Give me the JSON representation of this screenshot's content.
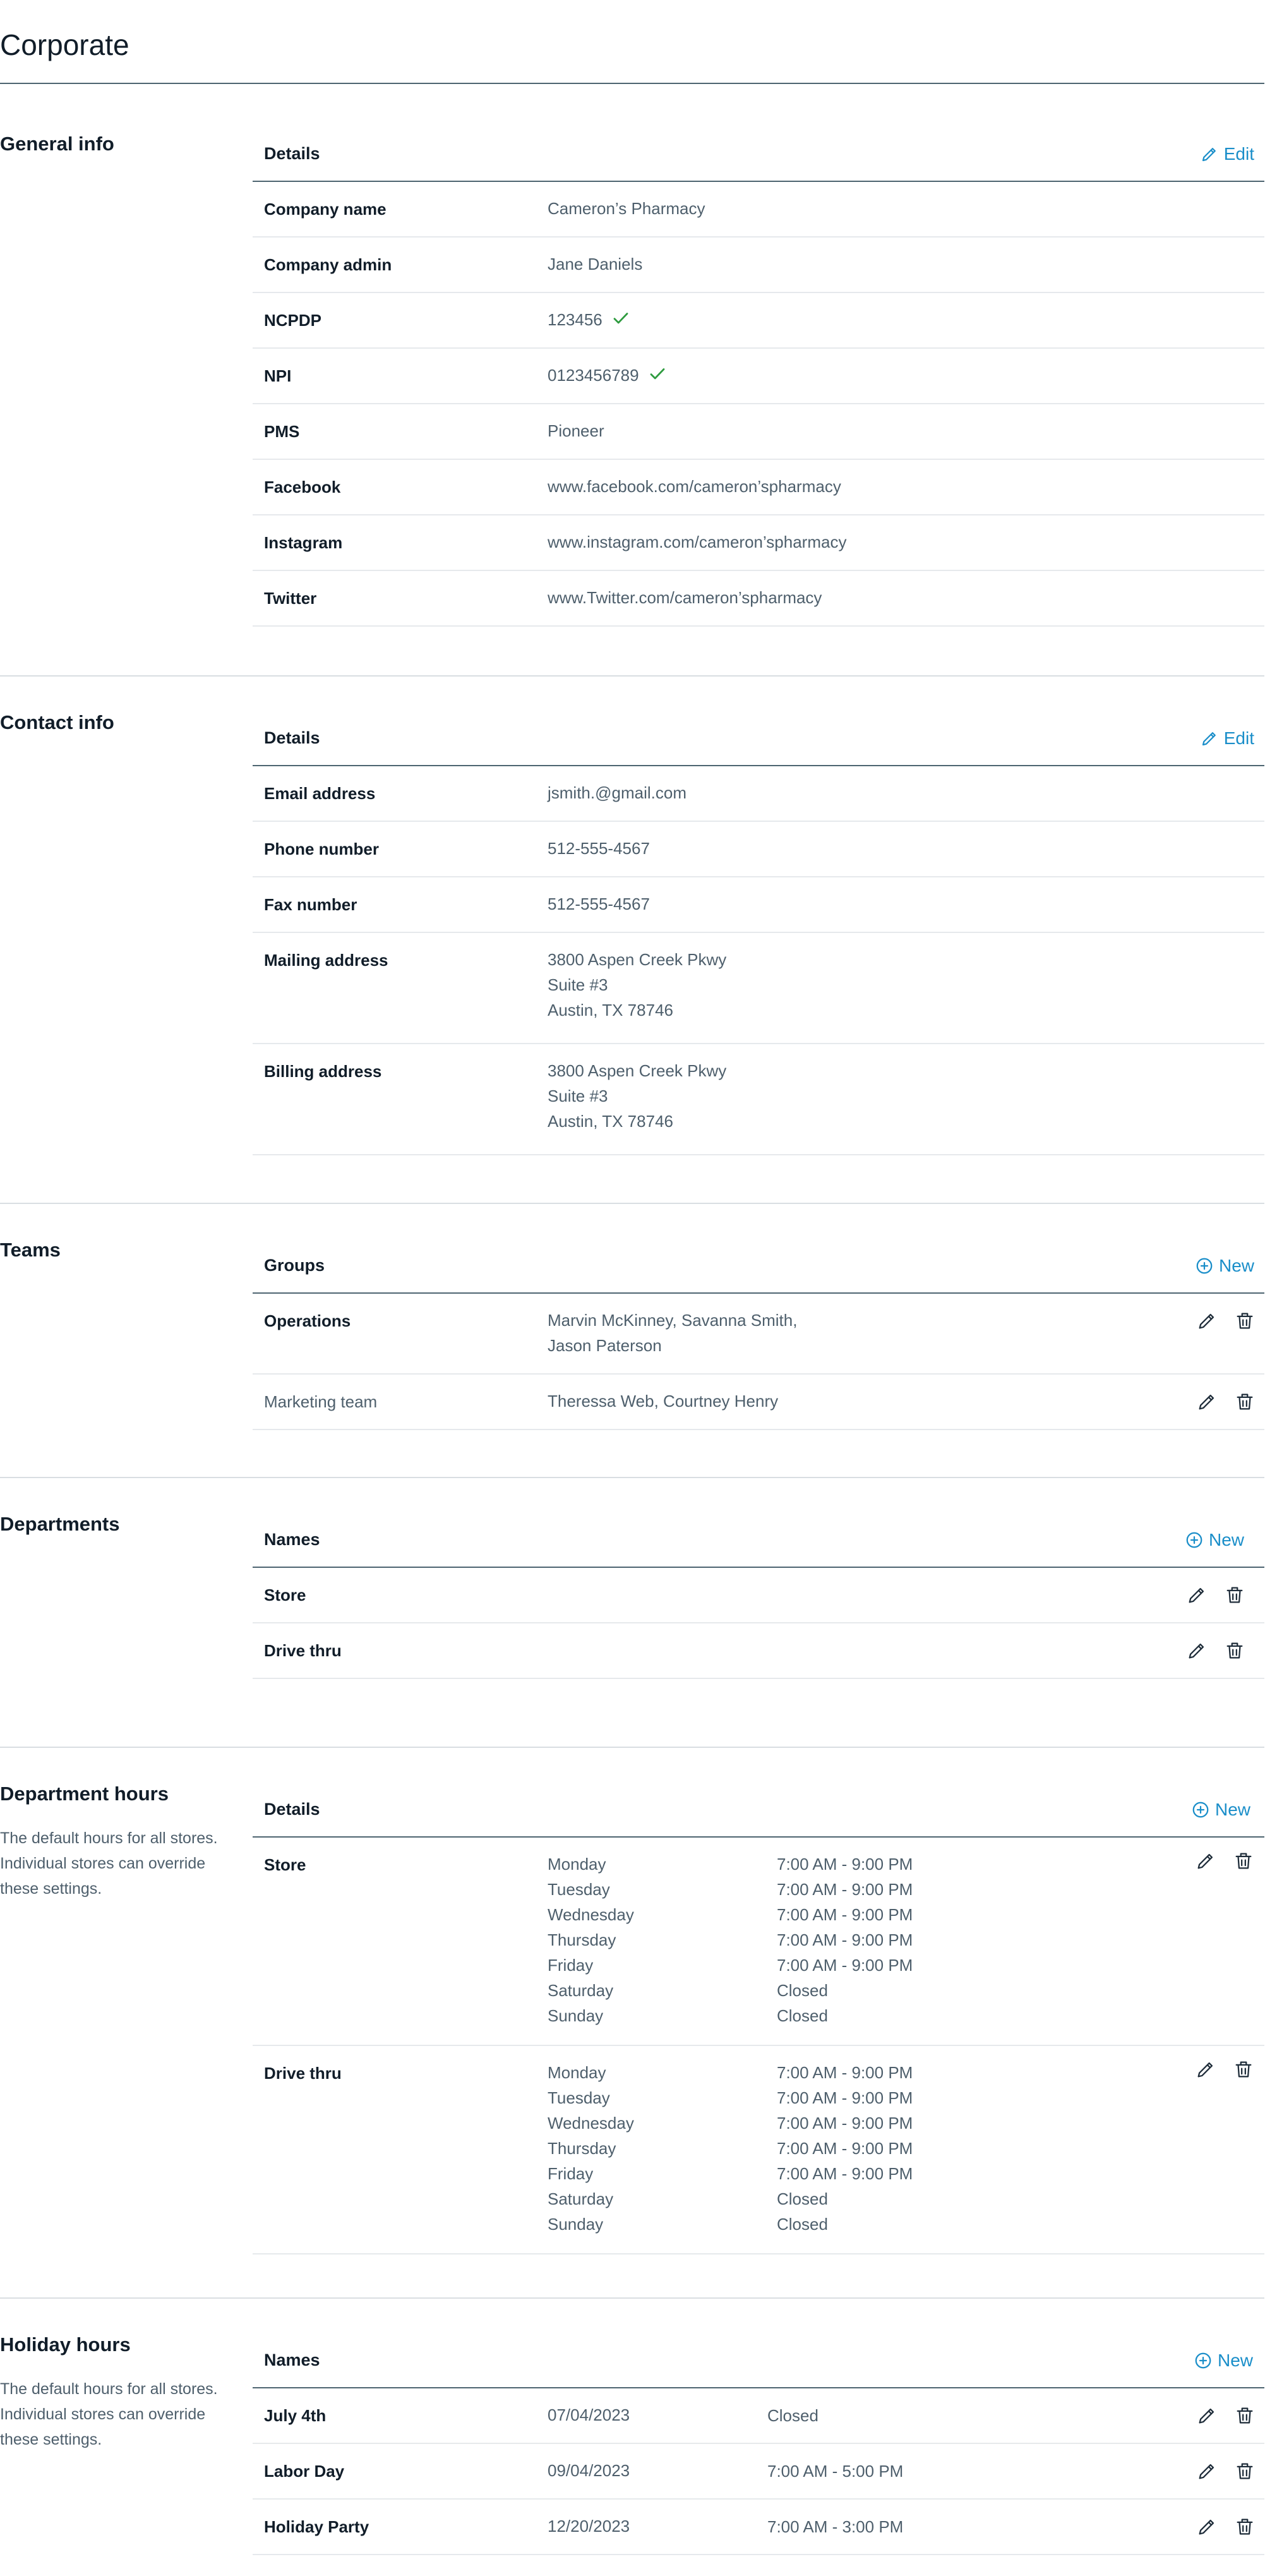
{
  "page": {
    "title": "Corporate"
  },
  "general": {
    "title": "General info",
    "header": "Details",
    "action": "Edit",
    "rows": [
      {
        "label": "Company name",
        "value": "Cameron’s Pharmacy"
      },
      {
        "label": "Company admin",
        "value": "Jane Daniels"
      },
      {
        "label": "NCPDP",
        "value": "123456",
        "verified": true
      },
      {
        "label": "NPI",
        "value": "0123456789",
        "verified": true
      },
      {
        "label": "PMS",
        "value": "Pioneer"
      },
      {
        "label": "Facebook",
        "value": "www.facebook.com/cameron’spharmacy"
      },
      {
        "label": "Instagram",
        "value": "www.instagram.com/cameron’spharmacy"
      },
      {
        "label": "Twitter",
        "value": "www.Twitter.com/cameron’spharmacy"
      }
    ]
  },
  "contact": {
    "title": "Contact info",
    "header": "Details",
    "action": "Edit",
    "rows": [
      {
        "label": "Email address",
        "value": "jsmith.@gmail.com"
      },
      {
        "label": "Phone number",
        "value": "512-555-4567"
      },
      {
        "label": "Fax number",
        "value": "512-555-4567"
      },
      {
        "label": "Mailing address",
        "line1": "3800 Aspen Creek Pkwy",
        "line2": "Suite #3",
        "line3": "Austin, TX 78746"
      },
      {
        "label": "Billing address",
        "line1": "3800 Aspen Creek Pkwy",
        "line2": "Suite #3",
        "line3": "Austin, TX 78746"
      }
    ]
  },
  "teams": {
    "title": "Teams",
    "header": "Groups",
    "action": "New",
    "rows": [
      {
        "label": "Operations",
        "line1": "Marvin McKinney, Savanna Smith,",
        "line2": "Jason Paterson"
      },
      {
        "label": "Marketing team",
        "value": "Theressa Web, Courtney Henry"
      }
    ]
  },
  "departments": {
    "title": "Departments",
    "header": "Names",
    "action": "New",
    "rows": [
      {
        "label": "Store"
      },
      {
        "label": "Drive thru"
      }
    ]
  },
  "dept_hours": {
    "title": "Department hours",
    "description": "The default hours for all stores. Individual stores can override these settings.",
    "header": "Details",
    "action": "New",
    "groups": [
      {
        "label": "Store",
        "days": [
          {
            "day": "Monday",
            "hours": "7:00 AM - 9:00 PM"
          },
          {
            "day": "Tuesday",
            "hours": "7:00 AM - 9:00 PM"
          },
          {
            "day": "Wednesday",
            "hours": "7:00 AM - 9:00 PM"
          },
          {
            "day": "Thursday",
            "hours": "7:00 AM - 9:00 PM"
          },
          {
            "day": "Friday",
            "hours": "7:00 AM - 9:00 PM"
          },
          {
            "day": "Saturday",
            "hours": "Closed"
          },
          {
            "day": "Sunday",
            "hours": "Closed"
          }
        ]
      },
      {
        "label": "Drive thru",
        "days": [
          {
            "day": "Monday",
            "hours": "7:00 AM - 9:00 PM"
          },
          {
            "day": "Tuesday",
            "hours": "7:00 AM - 9:00 PM"
          },
          {
            "day": "Wednesday",
            "hours": "7:00 AM - 9:00 PM"
          },
          {
            "day": "Thursday",
            "hours": "7:00 AM - 9:00 PM"
          },
          {
            "day": "Friday",
            "hours": "7:00 AM - 9:00 PM"
          },
          {
            "day": "Saturday",
            "hours": "Closed"
          },
          {
            "day": "Sunday",
            "hours": "Closed"
          }
        ]
      }
    ]
  },
  "holiday": {
    "title": "Holiday hours",
    "description": "The default hours for all stores. Individual stores can override these settings.",
    "header": "Names",
    "action": "New",
    "rows": [
      {
        "label": "July 4th",
        "date": "07/04/2023",
        "hours": "Closed"
      },
      {
        "label": "Labor Day",
        "date": "09/04/2023",
        "hours": "7:00 AM - 5:00 PM"
      },
      {
        "label": "Holiday Party",
        "date": "12/20/2023",
        "hours": "7:00 AM - 3:00 PM"
      }
    ]
  },
  "colors": {
    "accent": "#1a8ec9",
    "check": "#2e9b3f",
    "rule_dark": "#4d6470",
    "rule_light": "#e6e9ec"
  }
}
